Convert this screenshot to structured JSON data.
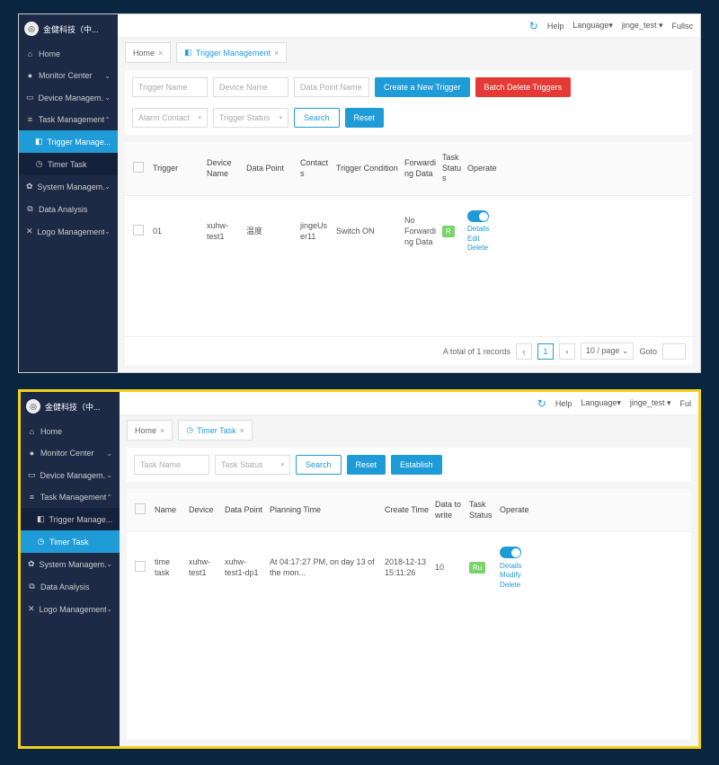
{
  "brand": "金健科技（中...",
  "topbar": {
    "help": "Help",
    "language": "Language",
    "user": "jinge_test",
    "fullscreen": "Fullsc"
  },
  "nav": {
    "home": "Home",
    "monitor": "Monitor Center",
    "device": "Device Managem...",
    "task": "Task Management",
    "trigger": "Trigger Manage...",
    "timer": "Timer Task",
    "system": "System Managem...",
    "data": "Data Analysis",
    "logo": "Logo Management"
  },
  "panel1": {
    "tabs": {
      "home": "Home",
      "trigger": "Trigger Management"
    },
    "filters": {
      "trigger_name": "Trigger Name",
      "device_name": "Device Name",
      "data_point_name": "Data Point Name",
      "alarm_contact": "Alarm Contact",
      "trigger_status": "Trigger Status",
      "search": "Search",
      "reset": "Reset",
      "create": "Create a New Trigger",
      "batch_delete": "Batch Delete Triggers"
    },
    "columns": {
      "trigger": "Trigger",
      "device": "Device Name",
      "datapoint": "Data Point",
      "contacts": "Contacts",
      "condition": "Trigger Condition",
      "forward": "Forwarding Data",
      "status": "Task Status",
      "operate": "Operate"
    },
    "row": {
      "trigger": "01",
      "device": "xuhw-test1",
      "datapoint": "温度",
      "contacts": "jingeUser11",
      "condition": "Switch ON",
      "forward": "No Forwarding Data",
      "status": "R",
      "ops": {
        "details": "Details",
        "edit": "Edit",
        "delete": "Delete"
      }
    },
    "pager": {
      "total": "A total of 1 records",
      "page": "1",
      "perpage": "10 / page",
      "goto": "Goto"
    }
  },
  "panel2": {
    "tabs": {
      "home": "Home",
      "timer": "Timer Task"
    },
    "filters": {
      "task_name": "Task Name",
      "task_status": "Task Status",
      "search": "Search",
      "reset": "Reset",
      "establish": "Establish"
    },
    "columns": {
      "name": "Name",
      "device": "Device",
      "datapoint": "Data Point",
      "planning": "Planning Time",
      "create": "Create Time",
      "datawrite": "Data to write",
      "status": "Task Status",
      "operate": "Operate"
    },
    "row": {
      "name": "time task",
      "device": "xuhw-test1",
      "datapoint": "xuhw-test1-dp1",
      "planning": "At 04:17:27 PM, on day 13 of the mon...",
      "create": "2018-12-13 15:11:26",
      "datawrite": "10",
      "status": "Ru",
      "ops": {
        "details": "Details",
        "modify": "Modify",
        "delete": "Delete"
      }
    }
  }
}
